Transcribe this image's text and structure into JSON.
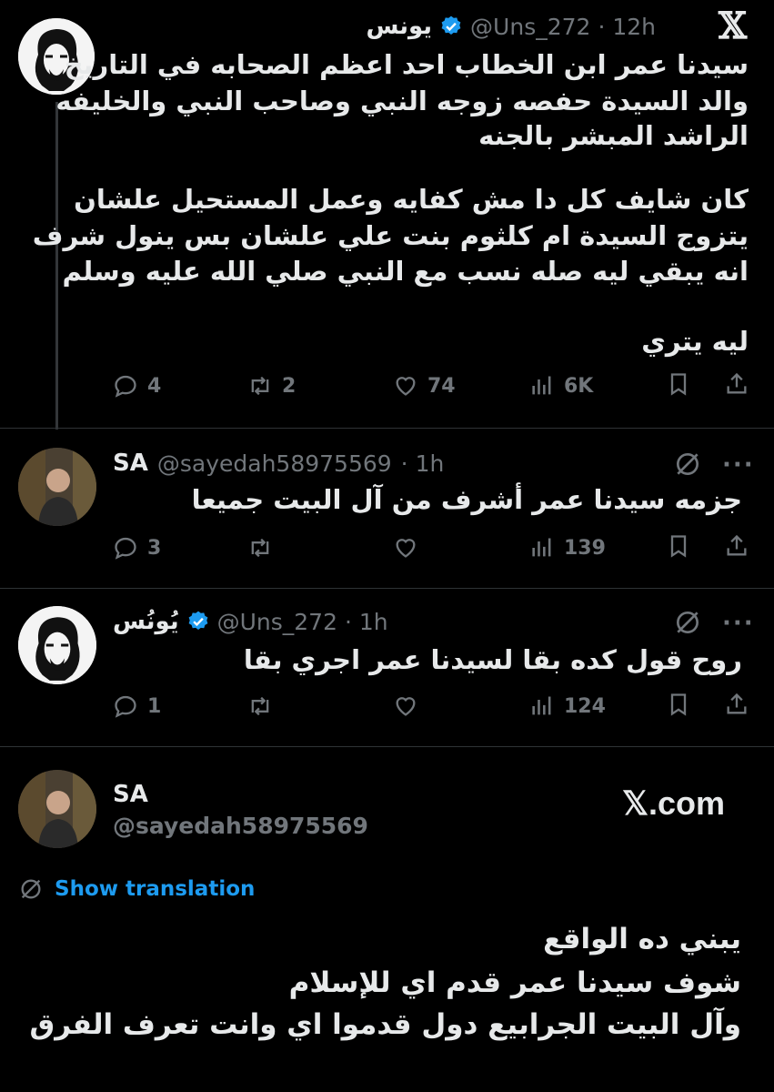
{
  "brand": {
    "logo_text": "𝕏"
  },
  "post1": {
    "name": "يونس",
    "handle": "@Uns_272",
    "time": "· 12h",
    "lines": [
      "سيدنا عمر ابن الخطاب احد اعظم الصحابه في التاريخ",
      "والد السيدة حفصه زوجه النبي وصاحب النبي والخليفه",
      "الراشد المبشر بالجنه",
      "كان شايف كل دا مش كفايه وعمل المستحيل علشان",
      "يتزوج السيدة ام كلثوم بنت علي علشان بس ينول شرف",
      "انه يبقي ليه صله نسب مع النبي صلي الله عليه وسلم",
      "ليه يتري"
    ],
    "replies": "4",
    "reposts": "2",
    "likes": "74",
    "views": "6K"
  },
  "post2": {
    "name": "SA",
    "handle": "@sayedah58975569",
    "time": "· 1h",
    "text": "جزمه سيدنا عمر أشرف من آل البيت جميعا",
    "replies": "3",
    "views": "139"
  },
  "post3": {
    "name": "يُونُس",
    "handle": "@Uns_272",
    "time": "· 1h",
    "text": "روح قول كده بقا لسيدنا عمر اجري بقا",
    "replies": "1",
    "views": "124"
  },
  "card": {
    "name": "SA",
    "handle": "@sayedah58975569",
    "site": "𝕏.com",
    "translation_label": "Show translation",
    "lines": [
      "يبني ده الواقع",
      "شوف سيدنا عمر قدم اي للإسلام",
      "وآل البيت الجرابيع دول قدموا اي وانت تعرف الفرق"
    ]
  },
  "colors": {
    "accent": "#1d9bf0",
    "muted": "#71767b",
    "text": "#e7e9ea",
    "bg": "#000000"
  }
}
